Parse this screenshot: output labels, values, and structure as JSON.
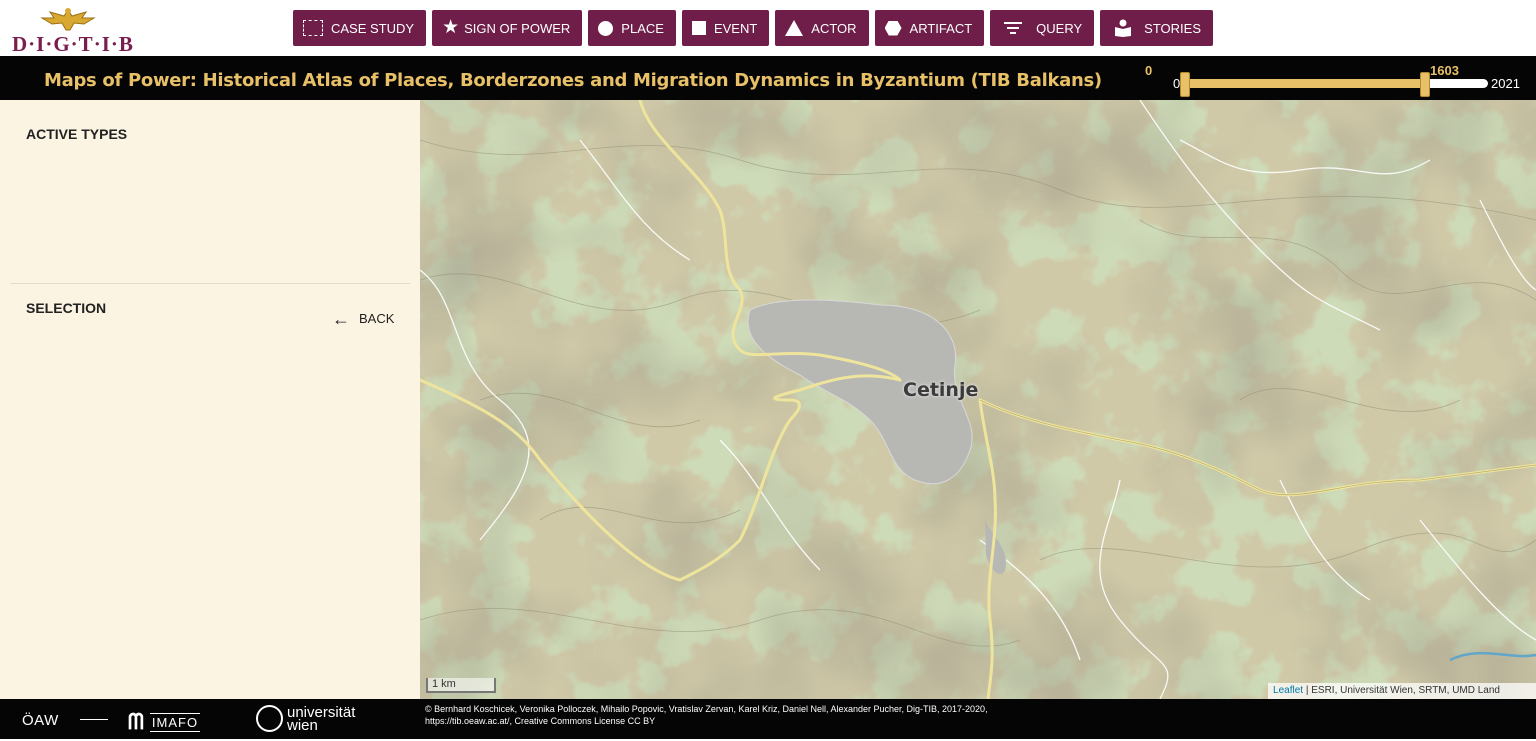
{
  "logo": {
    "text": "D·I·G·T·I·B"
  },
  "nav": [
    {
      "label": "CASE STUDY",
      "icon": "case-study-icon"
    },
    {
      "label": "SIGN OF POWER",
      "icon": "star-icon"
    },
    {
      "label": "PLACE",
      "icon": "circle-icon"
    },
    {
      "label": "EVENT",
      "icon": "square-icon"
    },
    {
      "label": "ACTOR",
      "icon": "triangle-icon"
    },
    {
      "label": "ARTIFACT",
      "icon": "hexagon-icon"
    },
    {
      "label": "QUERY",
      "icon": "filter-icon"
    },
    {
      "label": "STORIES",
      "icon": "book-reader-icon"
    }
  ],
  "header": {
    "title": "Maps of Power: Historical Atlas of Places, Borderzones and Migration Dynamics in Byzantium (TIB Balkans)"
  },
  "timeline": {
    "selected_min": "0",
    "selected_max": "1603",
    "range_min": "0",
    "range_max": "2021",
    "selected_fraction": 0.793
  },
  "sidebar": {
    "active_types": "ACTIVE TYPES",
    "selection": "SELECTION",
    "back": "BACK"
  },
  "map": {
    "city": "Cetinje",
    "scale": "1 km",
    "attribution_link": "Leaflet",
    "attribution_text": " | ESRI, Universität Wien, SRTM, UMD Land",
    "colors": {
      "terrain": "#c9c3a3",
      "forest": "#9fb57a",
      "road": "#f2e59a",
      "urban": "#b5b5b5"
    }
  },
  "footer": {
    "oaw": "ÖAW",
    "imafo": "IMAFO",
    "uw": "universität\nwien",
    "credits_line1": "© Bernhard Koschicek, Veronika Polloczek, Mihailo Popovic, Vratislav Zervan, Karel Kriz, Daniel Nell, Alexander Pucher, Dig-TIB, 2017-2020,",
    "credits_line2": "https://tib.oeaw.ac.at/, Creative Commons License CC BY"
  }
}
